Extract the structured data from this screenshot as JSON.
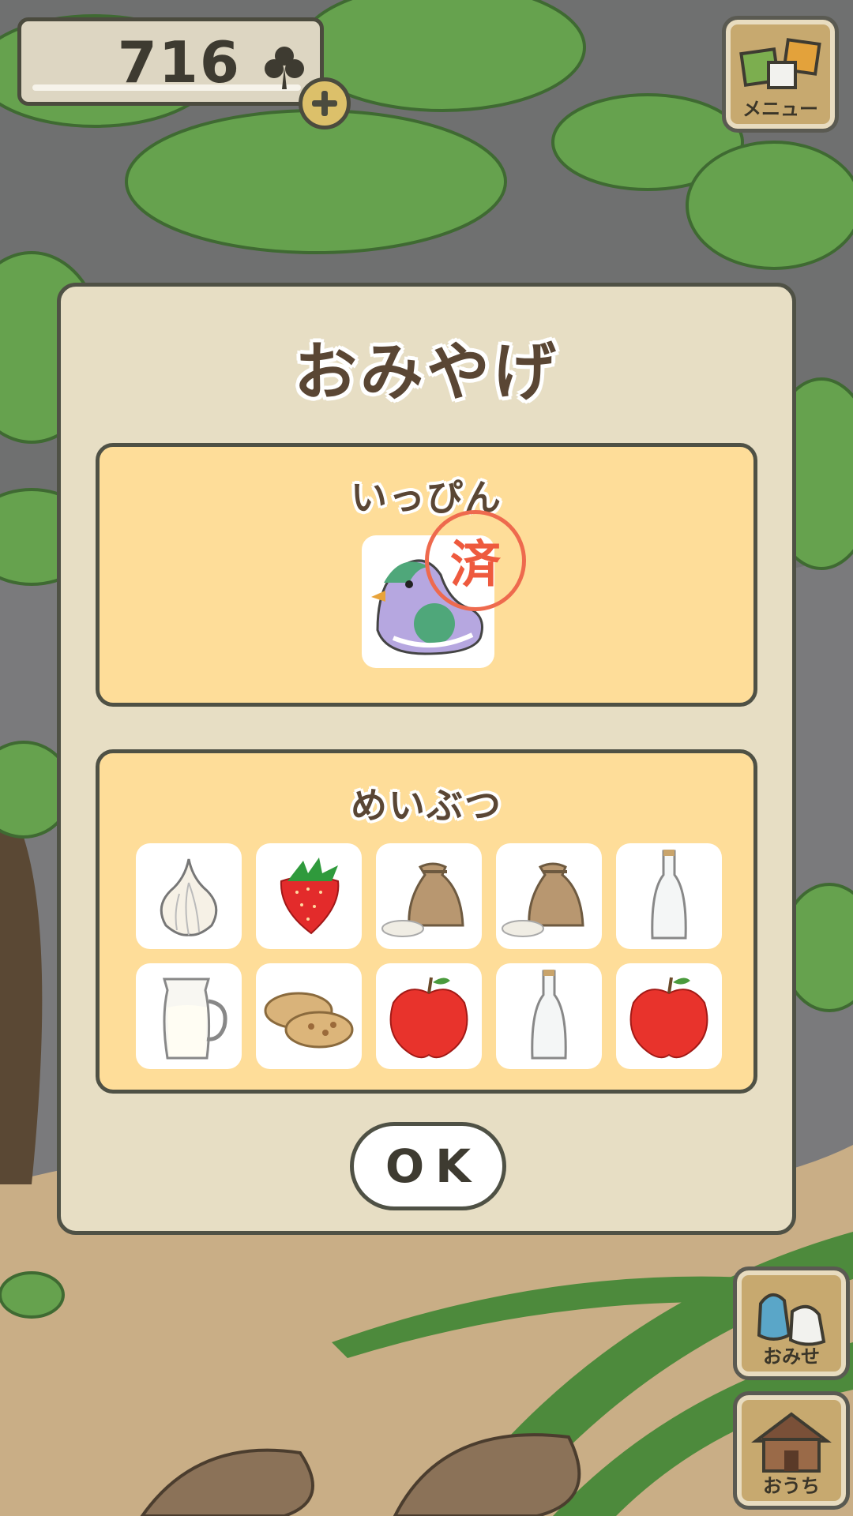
{
  "currency": {
    "amount": "716",
    "icon": "clover-icon"
  },
  "menu_button": {
    "label": "メニュー",
    "icon": "menu-icon"
  },
  "dialog": {
    "title": "おみやげ",
    "specialty": {
      "title": "いっぴん",
      "item": "duck-whistle",
      "stamp": "済"
    },
    "local_goods": {
      "title": "めいぶつ",
      "items": [
        "garlic",
        "strawberry",
        "rice-bag",
        "rice-bag",
        "glass-bottle",
        "milk-jug",
        "crackers",
        "apple",
        "glass-bottle",
        "apple"
      ]
    },
    "ok_label": "OK"
  },
  "shop_button": {
    "label": "おみせ",
    "icon": "shop-bags-icon"
  },
  "home_button": {
    "label": "おうち",
    "icon": "house-icon"
  },
  "colors": {
    "panel": "#e7dec4",
    "section": "#fedd99",
    "border": "#4f5145",
    "stamp": "#ee5a3e"
  }
}
